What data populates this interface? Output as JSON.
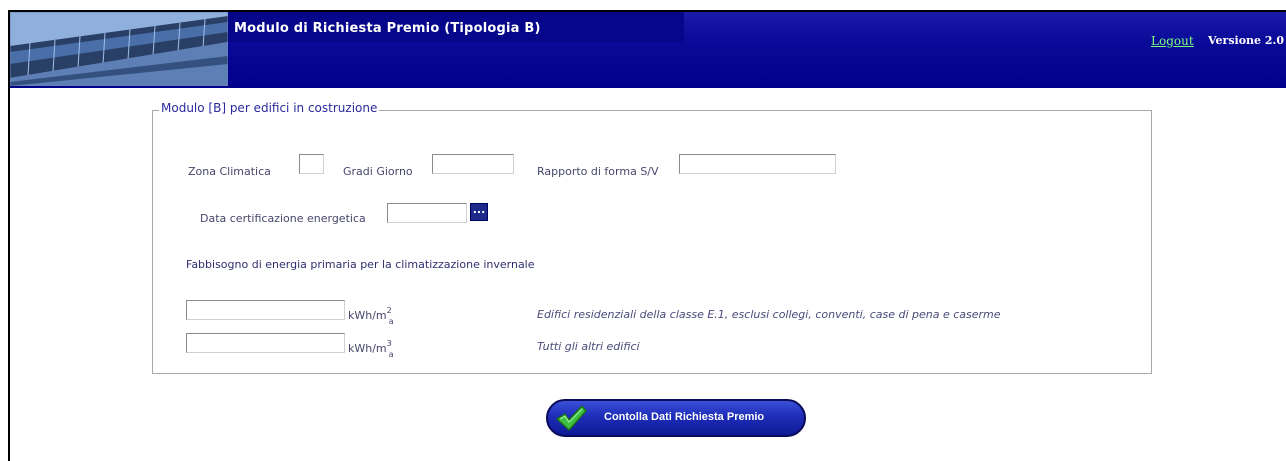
{
  "header": {
    "title": "Modulo di Richiesta Premio (Tipologia B)",
    "logout_label": "Logout",
    "version_label": "Versione 2.0"
  },
  "form": {
    "legend": "Modulo [B] per edifici in costruzione",
    "zona_climatica": {
      "label": "Zona Climatica",
      "value": ""
    },
    "gradi_giorno": {
      "label": "Gradi Giorno",
      "value": ""
    },
    "rapporto_forma": {
      "label": "Rapporto di forma S/V",
      "value": ""
    },
    "data_certificazione": {
      "label": "Data certificazione energetica",
      "value": "",
      "button_label": "..."
    },
    "fabbisogno_heading": "Fabbisogno di energia primaria per la climatizzazione invernale",
    "rows": [
      {
        "value": "",
        "unit_base": "kWh/m",
        "unit_exp": "2",
        "unit_sub": "a",
        "description": "Edifici residenziali della classe E.1, esclusi collegi, conventi, case di pena e caserme"
      },
      {
        "value": "",
        "unit_base": "kWh/m",
        "unit_exp": "3",
        "unit_sub": "a",
        "description": "Tutti gli altri edifici"
      }
    ]
  },
  "submit": {
    "label": "Contolla Dati Richiesta Premio"
  }
}
